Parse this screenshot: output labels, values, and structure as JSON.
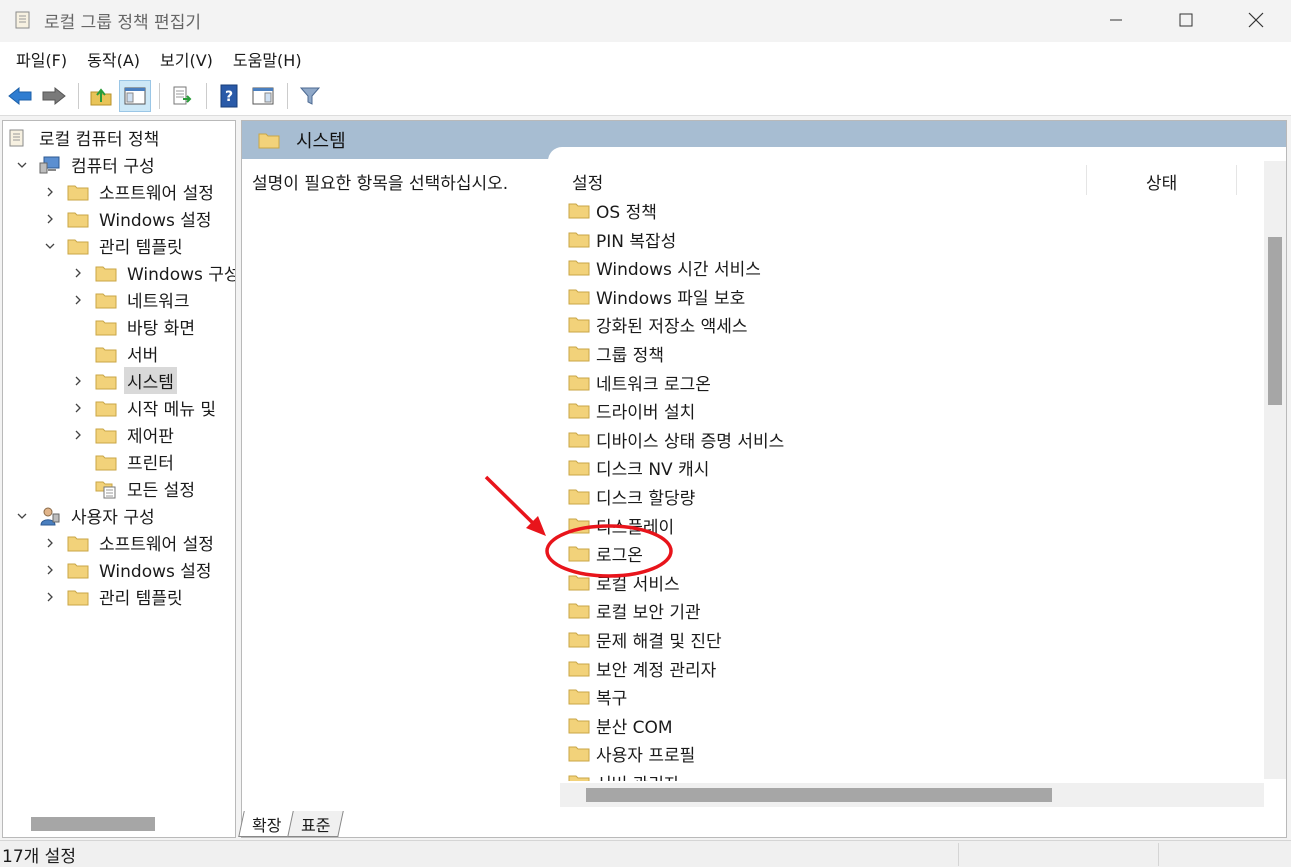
{
  "window": {
    "title": "로컬 그룹 정책 편집기"
  },
  "menu": [
    {
      "label": "파일(F)"
    },
    {
      "label": "동작(A)"
    },
    {
      "label": "보기(V)"
    },
    {
      "label": "도움말(H)"
    }
  ],
  "tree": {
    "root": "로컬 컴퓨터 정책",
    "computer_config": "컴퓨터 구성",
    "computer_children": {
      "software": "소프트웨어 설정",
      "windows": "Windows 설정",
      "admin": "관리 템플릿"
    },
    "admin_children": {
      "windows_components": "Windows 구성",
      "network": "네트워크",
      "desktop": "바탕 화면",
      "server": "서버",
      "system": "시스템",
      "start_menu": "시작 메뉴 및",
      "control_panel": "제어판",
      "printers": "프린터",
      "all_settings": "모든 설정"
    },
    "user_config": "사용자 구성",
    "user_children": {
      "software": "소프트웨어 설정",
      "windows": "Windows 설정",
      "admin": "관리 템플릿"
    }
  },
  "content": {
    "header_title": "시스템",
    "description": "설명이 필요한 항목을 선택하십시오.",
    "columns": {
      "settings": "설정",
      "status": "상태"
    },
    "items": [
      "OS 정책",
      "PIN 복잡성",
      "Windows 시간 서비스",
      "Windows 파일 보호",
      "강화된 저장소 액세스",
      "그룹 정책",
      "네트워크 로그온",
      "드라이버 설치",
      "디바이스 상태 증명 서비스",
      "디스크 NV 캐시",
      "디스크 할당량",
      "디스플레이",
      "로그온",
      "로컬 서비스",
      "로컬 보안 기관",
      "문제 해결 및 진단",
      "보안 계정 관리자",
      "복구",
      "분산 COM",
      "사용자 프로필",
      "서버 관리자"
    ],
    "highlighted_item": "로그온"
  },
  "tabs": {
    "extended": "확장",
    "standard": "표준"
  },
  "status": {
    "text": "17개 설정"
  },
  "colors": {
    "header_band": "#a7bdd2",
    "annotation": "#e8141b",
    "folder": "#f2d27a"
  }
}
